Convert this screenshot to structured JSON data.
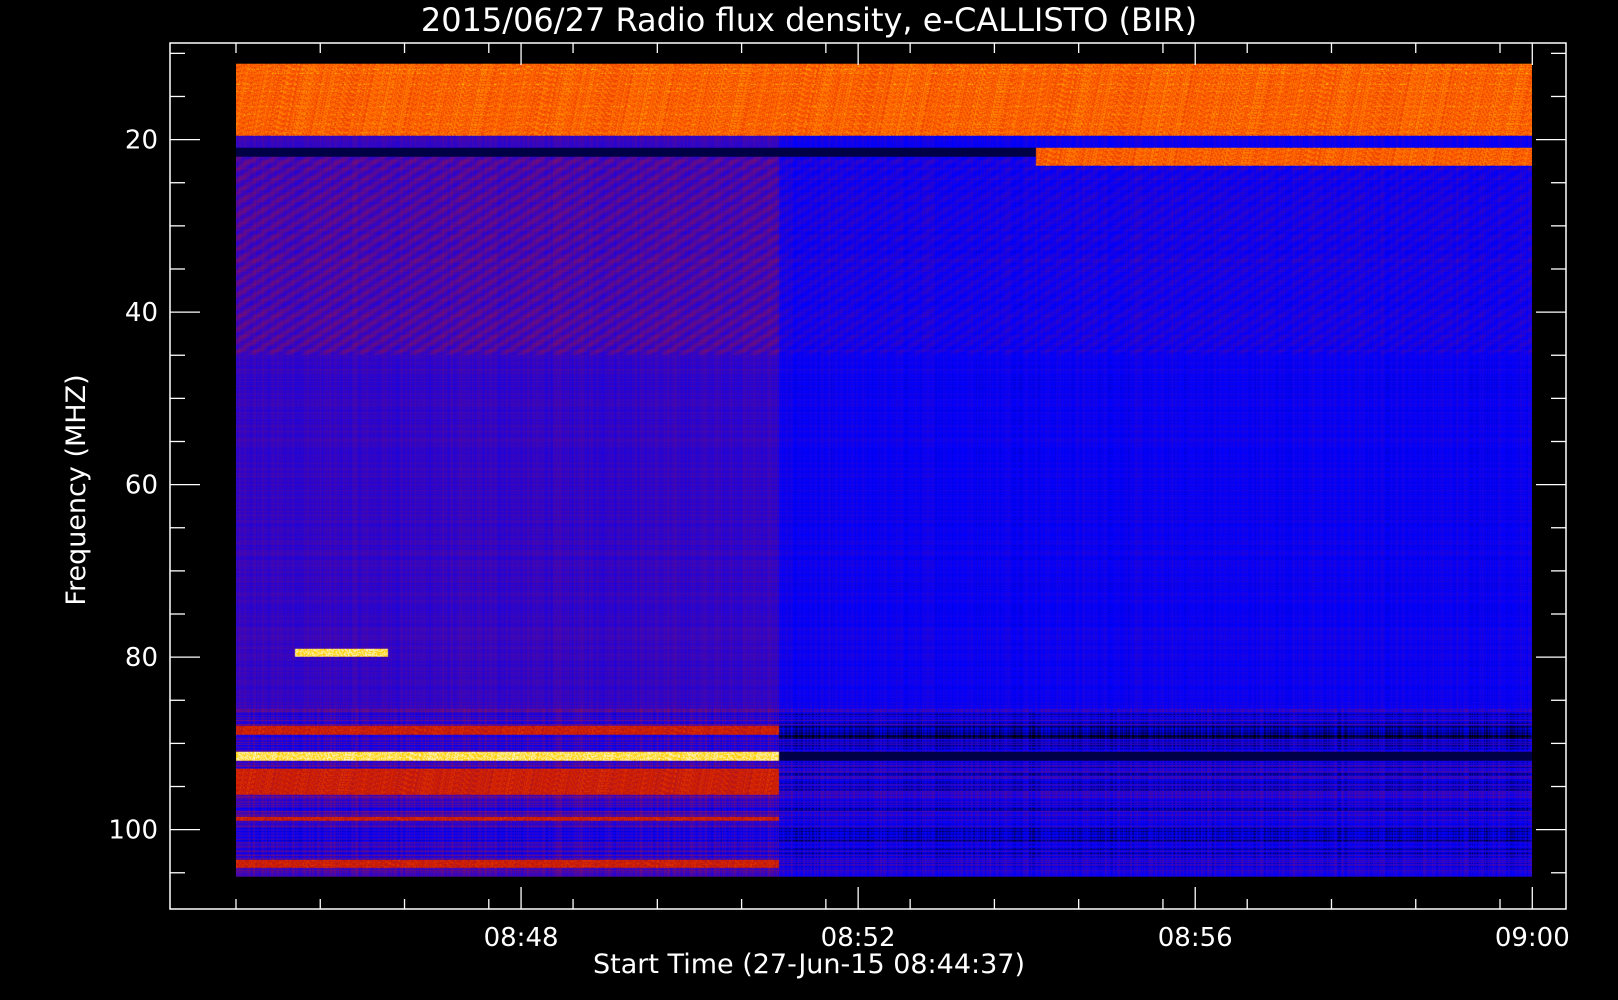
{
  "chart_data": {
    "type": "heatmap",
    "title": "2015/06/27  Radio flux density, e-CALLISTO (BIR)",
    "xlabel": "Start Time (27-Jun-15 08:44:37)",
    "ylabel": "Frequency (MHZ)",
    "x_ticks": [
      {
        "label": "08:48",
        "minutes": 3.383
      },
      {
        "label": "08:52",
        "minutes": 7.383
      },
      {
        "label": "08:56",
        "minutes": 11.383
      },
      {
        "label": "09:00",
        "minutes": 15.383
      }
    ],
    "y_ticks": [
      {
        "label": "20",
        "value": 20
      },
      {
        "label": "40",
        "value": 40
      },
      {
        "label": "60",
        "value": 60
      },
      {
        "label": "80",
        "value": 80
      },
      {
        "label": "100",
        "value": 100
      }
    ],
    "xlim_minutes_from_start": [
      -0.783,
      15.783
    ],
    "data_extent_minutes": [
      0,
      15.383
    ],
    "ylim_mhz": [
      8.8,
      109.2
    ],
    "y_inverted": true,
    "frequency_extent_mhz": [
      11.2,
      105.5
    ],
    "instrument_switch_minutes": 6.45,
    "colormap": [
      "#000000",
      "#0000ff",
      "#7a0d6e",
      "#cc1a00",
      "#ff5a00",
      "#ffd200",
      "#ffffff"
    ],
    "features": [
      {
        "name": "RFI band",
        "freq_mhz": [
          11.2,
          19.5
        ],
        "intensity": "high",
        "time_min": [
          0,
          15.383
        ]
      },
      {
        "name": "Emission band",
        "freq_mhz": [
          21,
          23
        ],
        "intensity": "high",
        "time_min": [
          9.5,
          15.383
        ]
      },
      {
        "name": "Emission spots",
        "freq_mhz": [
          79,
          80
        ],
        "intensity": "saturated",
        "time_min": [
          0.7,
          1.8
        ]
      },
      {
        "name": "Emission band",
        "freq_mhz": [
          91,
          92
        ],
        "intensity": "saturated",
        "time_min": [
          0,
          6.45
        ]
      },
      {
        "name": "Emission band",
        "freq_mhz": [
          88,
          89
        ],
        "intensity": "medium",
        "time_min": [
          0,
          6.45
        ]
      },
      {
        "name": "Emission band",
        "freq_mhz": [
          93,
          96
        ],
        "intensity": "medium",
        "time_min": [
          0,
          6.45
        ]
      },
      {
        "name": "Emission band",
        "freq_mhz": [
          98.5,
          99
        ],
        "intensity": "medium",
        "time_min": [
          0,
          6.45
        ]
      },
      {
        "name": "Emission band",
        "freq_mhz": [
          103.5,
          104.5
        ],
        "intensity": "medium",
        "time_min": [
          0,
          6.45
        ]
      }
    ]
  }
}
